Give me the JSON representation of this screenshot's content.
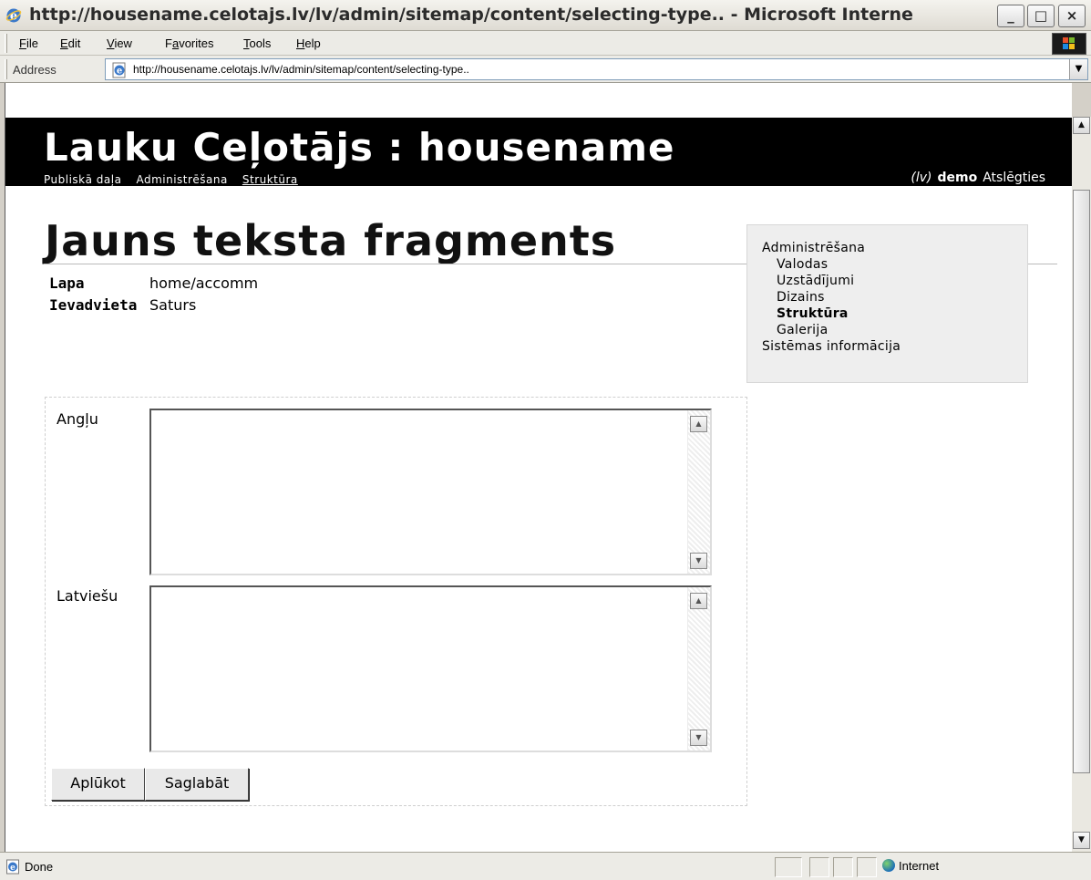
{
  "window": {
    "title": "http://housename.celotajs.lv/lv/admin/sitemap/content/selecting-type.. - Microsoft Interne",
    "min_glyph": "_",
    "max_glyph": "□",
    "close_glyph": "×"
  },
  "menubar": {
    "items": [
      {
        "u": "F",
        "rest": "ile"
      },
      {
        "u": "E",
        "rest": "dit"
      },
      {
        "u": "V",
        "rest": "iew"
      },
      {
        "pre": "F",
        "u": "a",
        "rest": "vorites"
      },
      {
        "u": "T",
        "rest": "ools"
      },
      {
        "u": "H",
        "rest": "elp"
      }
    ]
  },
  "addressbar": {
    "label": "Address",
    "url": "http://housename.celotajs.lv/lv/admin/sitemap/content/selecting-type..",
    "dropdown": "▼"
  },
  "site": {
    "title": "Lauku Ceļotājs : housename",
    "nav": [
      "Publiskā daļa",
      "Administrēšana",
      "Struktūra"
    ],
    "lang": "(lv)",
    "user": "demo",
    "logout": "Atslēgties"
  },
  "page": {
    "title": "Jauns teksta fragments",
    "meta": [
      {
        "key": "Lapa",
        "value": "home/accomm"
      },
      {
        "key": "Ievadvieta",
        "value": "Saturs"
      }
    ]
  },
  "sidebar": {
    "heading": "Administrēšana",
    "items": [
      "Valodas",
      "Uzstādījumi",
      "Dizains",
      "Struktūra",
      "Galerija"
    ],
    "active": "Struktūra",
    "footer": "Sistēmas informācija"
  },
  "form": {
    "fields": [
      {
        "label": "Angļu",
        "value": ""
      },
      {
        "label": "Latviešu",
        "value": ""
      }
    ],
    "preview_label": "Aplūkot",
    "save_label": "Saglabāt"
  },
  "statusbar": {
    "text": "Done",
    "zone": "Internet"
  },
  "scroll_glyphs": {
    "up": "▲",
    "down": "▼"
  }
}
